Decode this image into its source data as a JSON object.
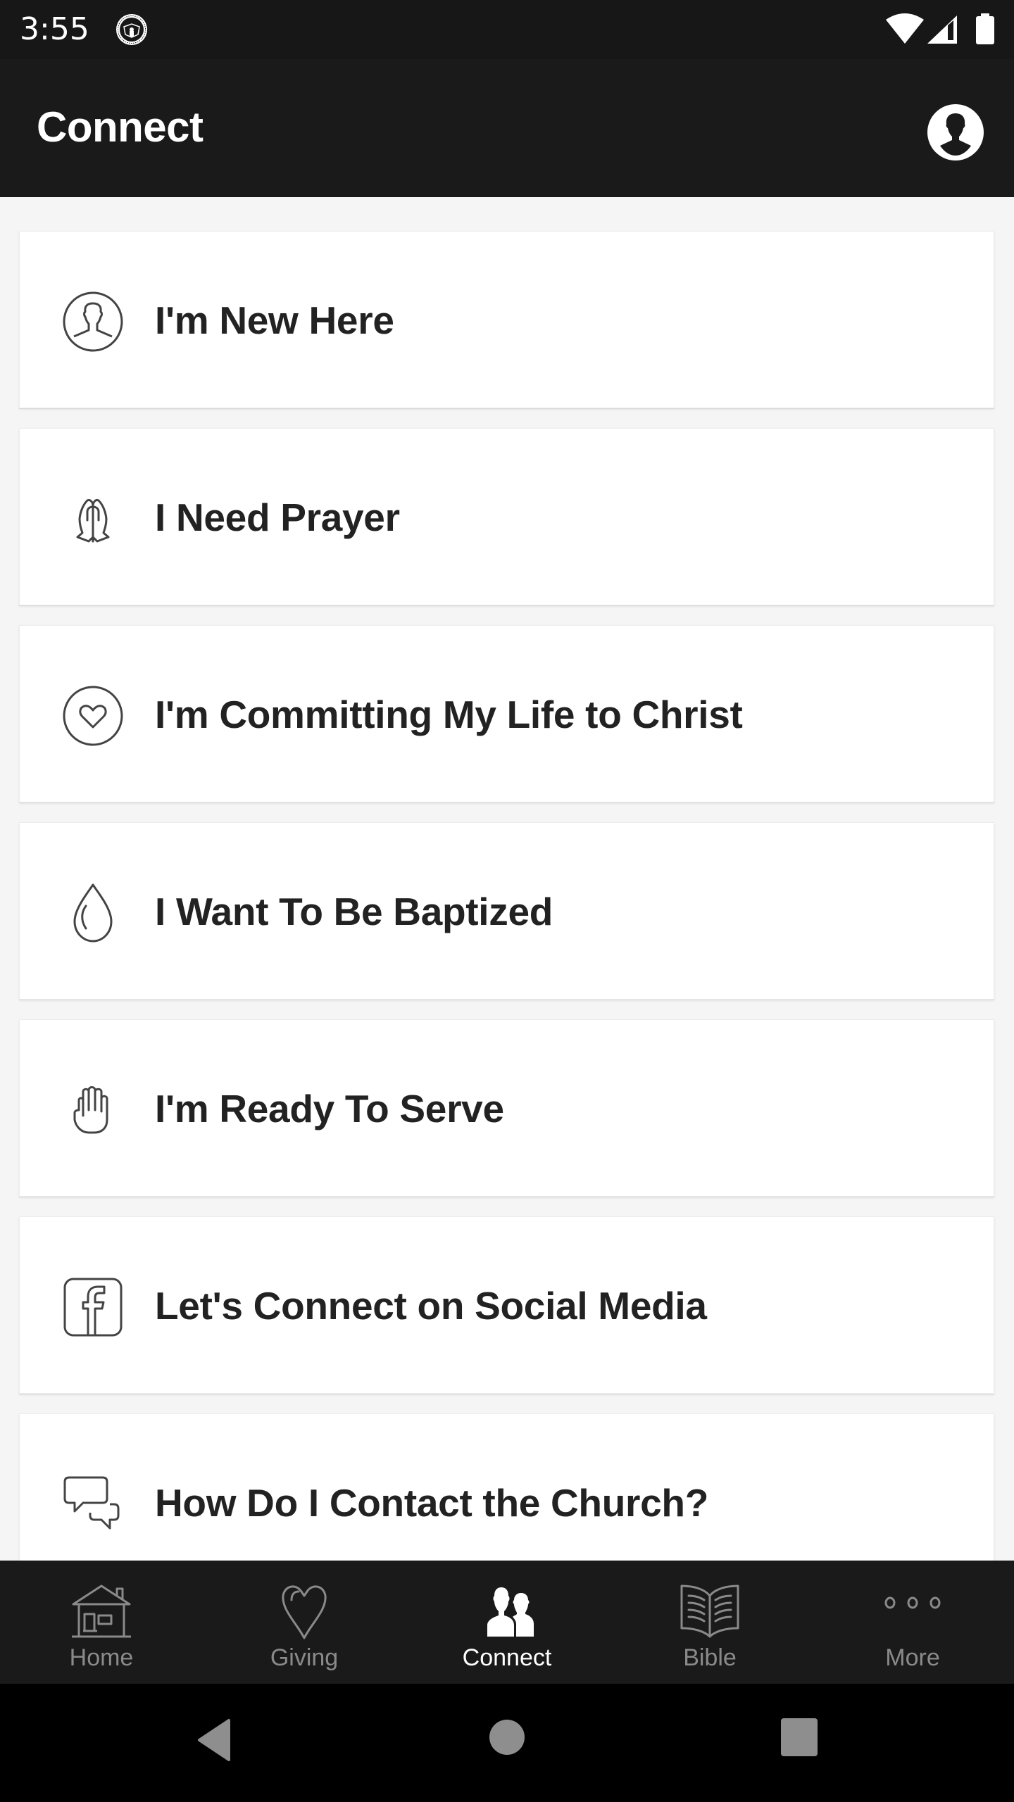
{
  "status_bar": {
    "time": "3:55",
    "notification_icon": "church-seal-icon",
    "icons": [
      "wifi-icon",
      "cell-signal-icon",
      "battery-icon"
    ]
  },
  "app_bar": {
    "title": "Connect",
    "profile_icon": "profile-icon"
  },
  "cards": [
    {
      "label": "I'm New Here",
      "icon": "person-circle-icon"
    },
    {
      "label": "I Need Prayer",
      "icon": "praying-hands-icon"
    },
    {
      "label": "I'm Committing My Life to Christ",
      "icon": "heart-circle-icon"
    },
    {
      "label": "I Want To Be Baptized",
      "icon": "water-drop-icon"
    },
    {
      "label": "I'm Ready To Serve",
      "icon": "raised-hand-icon"
    },
    {
      "label": "Let's Connect on Social Media",
      "icon": "facebook-icon"
    },
    {
      "label": "How Do I Contact the Church?",
      "icon": "chat-bubbles-icon"
    }
  ],
  "bottom_nav": {
    "items": [
      {
        "label": "Home",
        "icon": "home-icon",
        "active": false
      },
      {
        "label": "Giving",
        "icon": "heart-icon",
        "active": false
      },
      {
        "label": "Connect",
        "icon": "people-icon",
        "active": true
      },
      {
        "label": "Bible",
        "icon": "book-icon",
        "active": false
      },
      {
        "label": "More",
        "icon": "more-dots-icon",
        "active": false
      }
    ],
    "active_color": "#ffffff",
    "inactive_color": "#8a8a8a"
  },
  "system_nav": {
    "buttons": [
      "back",
      "home",
      "recents"
    ]
  }
}
